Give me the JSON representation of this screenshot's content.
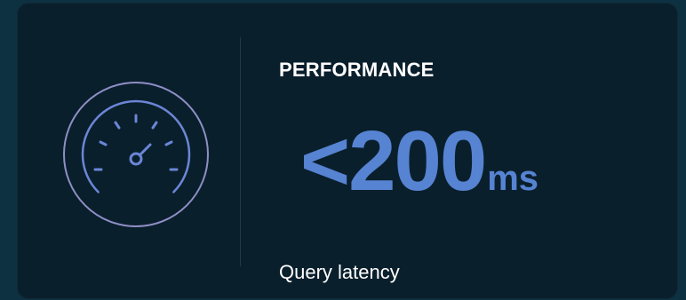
{
  "card": {
    "title": "PERFORMANCE",
    "metric_value": "<200",
    "metric_unit": "ms",
    "caption": "Query latency",
    "icon": "speedometer-icon"
  },
  "colors": {
    "background": "#0d3140",
    "card": "#0a1f2c",
    "accent": "#5683d2",
    "icon_ring": "#8f8fc6",
    "text": "#ffffff"
  }
}
